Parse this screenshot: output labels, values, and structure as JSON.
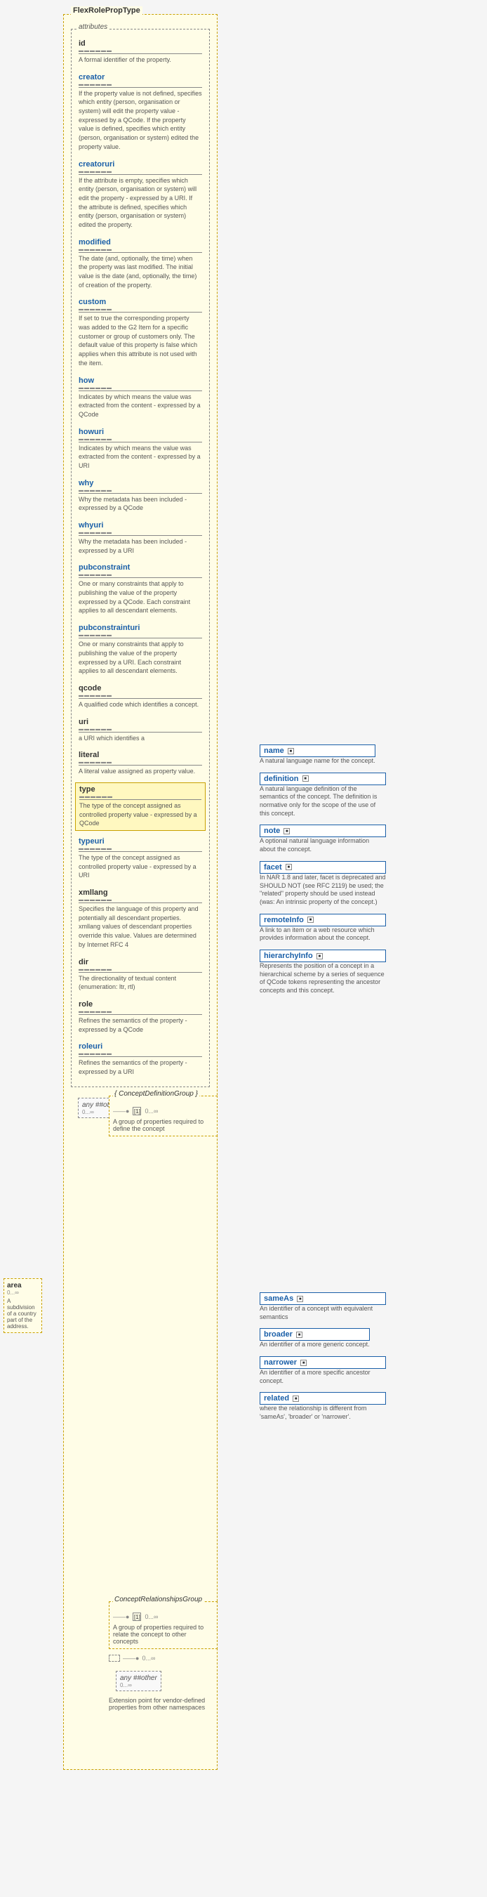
{
  "title": "FlexRolePropType",
  "attributes": {
    "label": "attributes",
    "items": [
      {
        "name": "id",
        "underline": "▬▬▬▬▬▬",
        "desc": "A formal identifier of the property."
      },
      {
        "name": "creator",
        "link": true,
        "underline": "▬▬▬▬▬▬",
        "desc": "If the property value is not defined, specifies which entity (person, organisation or system) will edit the property value - expressed by a QCode. If the property value is defined, specifies which entity (person, organisation or system) edited the property value."
      },
      {
        "name": "creatoruri",
        "link": true,
        "underline": "▬▬▬▬▬▬",
        "desc": "If the attribute is empty, specifies which entity (person, organisation or system) will edit the property - expressed by a URI. If the attribute is defined, specifies which entity (person, organisation or system) edited the property."
      },
      {
        "name": "modified",
        "link": true,
        "underline": "▬▬▬▬▬▬",
        "desc": "The date (and, optionally, the time) when the property was last modified. The initial value is the date (and, optionally, the time) of creation of the property."
      },
      {
        "name": "custom",
        "link": true,
        "underline": "▬▬▬▬▬▬",
        "desc": "If set to true the corresponding property was added to the G2 Item for a specific customer or group of customers only. The default value of this property is false which applies when this attribute is not used with the item."
      },
      {
        "name": "how",
        "link": true,
        "underline": "▬▬▬▬▬▬",
        "desc": "Indicates by which means the value was extracted from the content - expressed by a QCode"
      },
      {
        "name": "howuri",
        "link": true,
        "underline": "▬▬▬▬▬▬",
        "desc": "Indicates by which means the value was extracted from the content - expressed by a URI"
      },
      {
        "name": "why",
        "link": true,
        "underline": "▬▬▬▬▬▬",
        "desc": "Why the metadata has been included - expressed by a QCode"
      },
      {
        "name": "whyuri",
        "link": true,
        "underline": "▬▬▬▬▬▬",
        "desc": "Why the metadata has been included - expressed by a URI"
      },
      {
        "name": "pubconstraint",
        "link": true,
        "underline": "▬▬▬▬▬▬",
        "desc": "One or many constraints that apply to publishing the value of the property expressed by a QCode. Each constraint applies to all descendant elements."
      },
      {
        "name": "pubconstrainturi",
        "link": true,
        "underline": "▬▬▬▬▬▬",
        "desc": "One or many constraints that apply to publishing the value of the property expressed by a URI. Each constraint applies to all descendant elements."
      },
      {
        "name": "qcode",
        "underline": "▬▬▬▬▬▬",
        "desc": "A qualified code which identifies a concept."
      },
      {
        "name": "uri",
        "underline": "▬▬▬▬▬▬",
        "desc": "a URI which identifies a"
      },
      {
        "name": "literal",
        "underline": "▬▬▬▬▬▬",
        "desc": "A literal value assigned as property value."
      },
      {
        "name": "type",
        "underline": "▬▬▬▬▬▬",
        "desc": "The type of the concept assigned as controlled property value - expressed by a QCode",
        "highlight": true
      },
      {
        "name": "typeuri",
        "link": true,
        "underline": "▬▬▬▬▬▬",
        "desc": "The type of the concept assigned as controlled property value - expressed by a URI"
      },
      {
        "name": "xmllang",
        "underline": "▬▬▬▬▬▬",
        "desc": "Specifies the language of this property and potentially all descendant properties. xmllang values of descendant properties override this value. Values are determined by Internet RFC 4"
      },
      {
        "name": "dir",
        "underline": "▬▬▬▬▬▬",
        "desc": "The directionality of textual content (enumeration: ltr, rtl)"
      },
      {
        "name": "role",
        "underline": "▬▬▬▬▬▬",
        "desc": "Refines the semantics of the property - expressed by a QCode"
      },
      {
        "name": "roleuri",
        "link": true,
        "underline": "▬▬▬▬▬▬",
        "desc": "Refines the semantics of the property - expressed by a URI"
      }
    ]
  },
  "anyOther": {
    "label": "any ##other",
    "sub": "0...∞"
  },
  "areaBox": {
    "title": "area",
    "sub": "0...∞",
    "desc": "A subdivision of a country part of the address."
  },
  "rightPanel": {
    "top": [
      {
        "name": "name",
        "icon": "■",
        "desc": "A natural language name for the concept."
      },
      {
        "name": "definition",
        "icon": "■",
        "desc": "A natural language definition of the semantics of the concept. The definition is normative only for the scope of the use of this concept."
      },
      {
        "name": "note",
        "icon": "■",
        "desc": "A optional natural language information about the concept."
      },
      {
        "name": "facet",
        "icon": "■",
        "desc": "In NAR 1.8 and later, facet is deprecated and SHOULD NOT (see RFC 2119) be used; the \"related\" property should be used instead (was: An intrinsic property of the concept.)"
      },
      {
        "name": "remoteInfo",
        "icon": "■",
        "desc": "A link to an item or a web resource which provides information about the concept."
      },
      {
        "name": "hierarchyInfo",
        "icon": "■",
        "desc": "Represents the position of a concept in a hierarchical scheme by a series of sequence of QCode tokens representing the ancestor concepts and this concept."
      }
    ],
    "sameAs": {
      "name": "sameAs",
      "icon": "■",
      "desc": "An identifier of a concept with equivalent semantics"
    },
    "broader": {
      "name": "broader",
      "icon": "■",
      "desc": "An identifier of a more generic concept."
    },
    "narrower": {
      "name": "narrower",
      "icon": "■",
      "desc": "An identifier of a more specific ancestor concept."
    },
    "related": {
      "name": "related",
      "icon": "■",
      "desc": "where the relationship is different from 'sameAs', 'broader' or 'narrower'."
    }
  },
  "conceptDefGroup": {
    "label": "{ ConceptDefinitionGroup }",
    "multiplicity1": "——●",
    "multiplicity2": "0...∞",
    "desc": "A group of properties required to define the concept"
  },
  "conceptRelGroup": {
    "label": "ConceptRelationshipsGroup",
    "multiplicity1": "——●",
    "multiplicity2": "0...∞",
    "desc": "A group of properties required to relate the concept to other concepts"
  },
  "anyOtherBottom": {
    "label": "any ##other",
    "sub": "0...∞",
    "desc": "Extension point for vendor-defined properties from other namespaces"
  },
  "connector": {
    "multiplicity_top": "——●",
    "multiplicity_val": "0...∞"
  }
}
